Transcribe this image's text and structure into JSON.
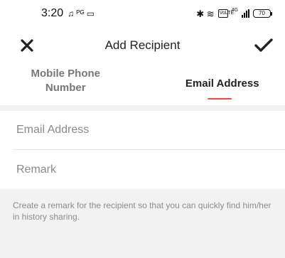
{
  "status_bar": {
    "time": "3:20",
    "left_glyphs": "♫ ᴾᴳ ▭",
    "right_glyphs": "✱ ≋",
    "volte": "VoLTE",
    "network": "4G",
    "battery": "70"
  },
  "header": {
    "title": "Add Recipient",
    "close_icon": "close-icon",
    "confirm_icon": "checkmark-icon"
  },
  "tabs": [
    {
      "label": "Mobile Phone Number",
      "active": false
    },
    {
      "label": "Email Address",
      "active": true
    }
  ],
  "accent_color": "#ee4c3e",
  "form": {
    "email_placeholder": "Email Address",
    "email_value": "",
    "remark_placeholder": "Remark",
    "remark_value": ""
  },
  "hint": "Create a remark for the recipient so that you can quickly find him/her in history sharing."
}
